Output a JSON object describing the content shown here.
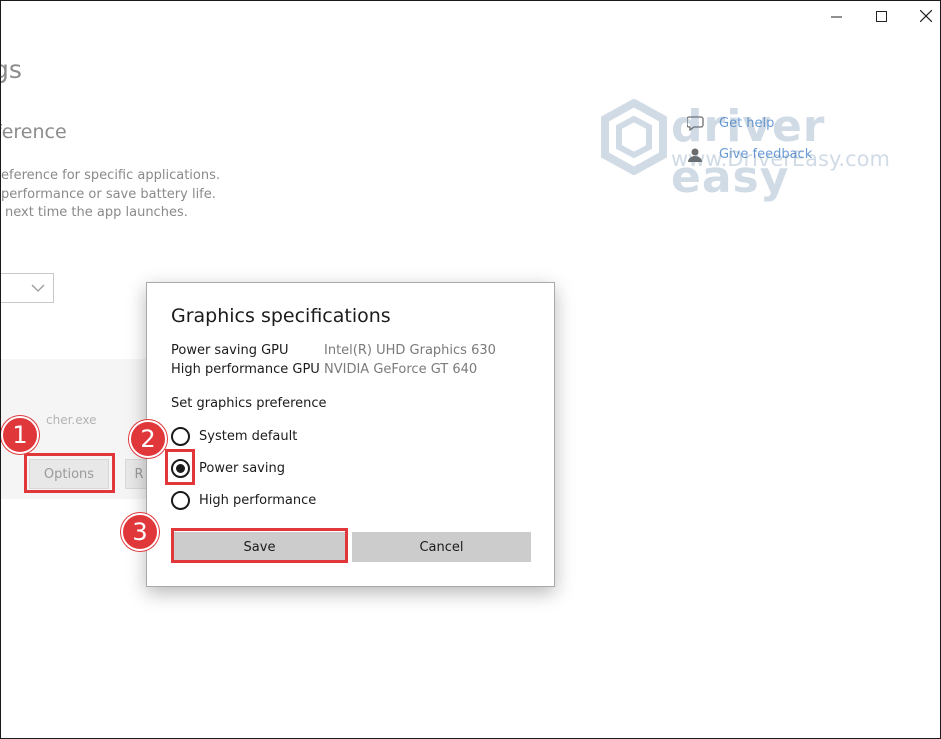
{
  "window": {
    "controls": {
      "minimize_icon": "minimize-icon",
      "maximize_icon": "maximize-icon",
      "close_icon": "close-icon"
    }
  },
  "background": {
    "title": "gs",
    "subtitle": "ference",
    "description": [
      "eference for specific applications.",
      "performance or save battery life.",
      "next time the app launches."
    ],
    "app_name": "cher.exe",
    "options_label": "Options",
    "remove_label_partial": "R"
  },
  "help": {
    "get_help": "Get help",
    "give_feedback": "Give feedback"
  },
  "watermark": {
    "brand": "driver easy",
    "url": "www.DriverEasy.com"
  },
  "dialog": {
    "title": "Graphics specifications",
    "specs": [
      {
        "label": "Power saving GPU",
        "value": "Intel(R) UHD Graphics 630"
      },
      {
        "label": "High performance GPU",
        "value": "NVIDIA GeForce GT 640"
      }
    ],
    "preference_label": "Set graphics preference",
    "options": [
      {
        "label": "System default",
        "checked": false
      },
      {
        "label": "Power saving",
        "checked": true
      },
      {
        "label": "High performance",
        "checked": false
      }
    ],
    "save_label": "Save",
    "cancel_label": "Cancel"
  },
  "steps": [
    "1",
    "2",
    "3"
  ],
  "colors": {
    "highlight": "#e0373b",
    "link": "#6a9bd6",
    "button": "#cccccc"
  }
}
